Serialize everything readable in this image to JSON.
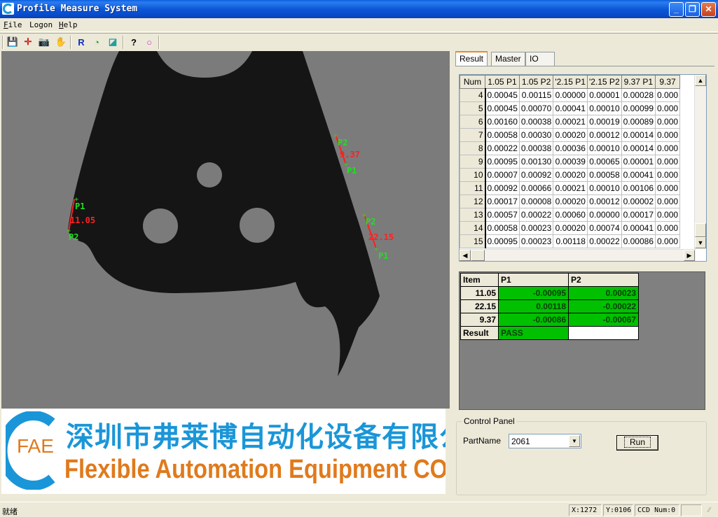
{
  "window": {
    "title": "Profile Measure System",
    "icon": "fae-logo-icon",
    "controls": {
      "minimize": "_",
      "restore": "❐",
      "close": "✕"
    }
  },
  "menu": [
    {
      "label_underlined": "F",
      "label_rest": "ile"
    },
    {
      "label_underlined": "",
      "label_rest": "Logon"
    },
    {
      "label_underlined": "H",
      "label_rest": "elp"
    }
  ],
  "toolbar": [
    {
      "name": "save-icon",
      "glyph": "💾",
      "color": "#000000"
    },
    {
      "name": "crosshair-icon",
      "glyph": "✛",
      "color": "#d02020"
    },
    {
      "name": "camera-icon",
      "glyph": "📷",
      "color": "#000000"
    },
    {
      "name": "hand-icon",
      "glyph": "✋",
      "color": "#e0c000"
    },
    {
      "name": "r-icon",
      "glyph": "R",
      "color": "#1030c0"
    },
    {
      "name": "measure-icon",
      "glyph": "◔",
      "color": "#20a020"
    },
    {
      "name": "ruler-icon",
      "glyph": "◪",
      "color": "#20a0a0"
    },
    {
      "name": "help-icon",
      "glyph": "?",
      "color": "#000000"
    },
    {
      "name": "circle-icon",
      "glyph": "○",
      "color": "#e020e0"
    }
  ],
  "viewer": {
    "measurements": [
      {
        "label": "11.05",
        "p1": "P1",
        "p2": "P2"
      },
      {
        "label": "9.37",
        "p1": "P1",
        "p2": "P2"
      },
      {
        "label": "22.15",
        "p1": "P1",
        "p2": "P2"
      }
    ],
    "colors": {
      "measure_line": "#ff2020",
      "point_label": "#20e020",
      "background": "#7b7b7b",
      "part": "#151515"
    }
  },
  "banner": {
    "company_cn": "深圳市弗莱博自动化设备有限公司",
    "company_en": "Flexible Automation Equipment CO.,LTD",
    "logo_text": "FAE",
    "colors": {
      "blue": "#1a96d8",
      "orange": "#e07a1c"
    }
  },
  "tabs": [
    {
      "label": "Result",
      "active": true
    },
    {
      "label": "Master",
      "active": false
    },
    {
      "label": "IO",
      "active": false
    }
  ],
  "results_grid": {
    "columns": [
      "Num",
      "1.05 P1",
      "1.05 P2",
      "'2.15 P1",
      "'2.15 P2",
      "9.37 P1",
      "9.37"
    ],
    "rows": [
      [
        "4",
        "0.00045",
        "0.00115",
        "0.00000",
        "0.00001",
        "0.00028",
        "0.000"
      ],
      [
        "5",
        "0.00045",
        "0.00070",
        "0.00041",
        "0.00010",
        "0.00099",
        "0.000"
      ],
      [
        "6",
        "0.00160",
        "0.00038",
        "0.00021",
        "0.00019",
        "0.00089",
        "0.000"
      ],
      [
        "7",
        "0.00058",
        "0.00030",
        "0.00020",
        "0.00012",
        "0.00014",
        "0.000"
      ],
      [
        "8",
        "0.00022",
        "0.00038",
        "0.00036",
        "0.00010",
        "0.00014",
        "0.000"
      ],
      [
        "9",
        "0.00095",
        "0.00130",
        "0.00039",
        "0.00065",
        "0.00001",
        "0.000"
      ],
      [
        "10",
        "0.00007",
        "0.00092",
        "0.00020",
        "0.00058",
        "0.00041",
        "0.000"
      ],
      [
        "11",
        "0.00092",
        "0.00066",
        "0.00021",
        "0.00010",
        "0.00106",
        "0.000"
      ],
      [
        "12",
        "0.00017",
        "0.00008",
        "0.00020",
        "0.00012",
        "0.00002",
        "0.000"
      ],
      [
        "13",
        "0.00057",
        "0.00022",
        "0.00060",
        "0.00000",
        "0.00017",
        "0.000"
      ],
      [
        "14",
        "0.00058",
        "0.00023",
        "0.00020",
        "0.00074",
        "0.00041",
        "0.000"
      ],
      [
        "15",
        "0.00095",
        "0.00023",
        "0.00118",
        "0.00022",
        "0.00086",
        "0.000"
      ]
    ]
  },
  "summary": {
    "headers": [
      "Item",
      "P1",
      "P2"
    ],
    "rows": [
      {
        "item": "11.05",
        "p1": "-0.00095",
        "p2": "0.00023"
      },
      {
        "item": "22.15",
        "p1": "0.00118",
        "p2": "-0.00022"
      },
      {
        "item": "9.37",
        "p1": "-0.00086",
        "p2": "-0.00067"
      }
    ],
    "result_label": "Result",
    "result_value": "PASS",
    "pass_color": "#00c000"
  },
  "control_panel": {
    "title": "Control Panel",
    "partname_label": "PartName",
    "partname_value": "2061",
    "run_label": "Run"
  },
  "statusbar": {
    "status": "就绪",
    "x": "X:1272",
    "y": "Y:0106",
    "ccd": "CCD Num:0",
    "extra": ""
  }
}
